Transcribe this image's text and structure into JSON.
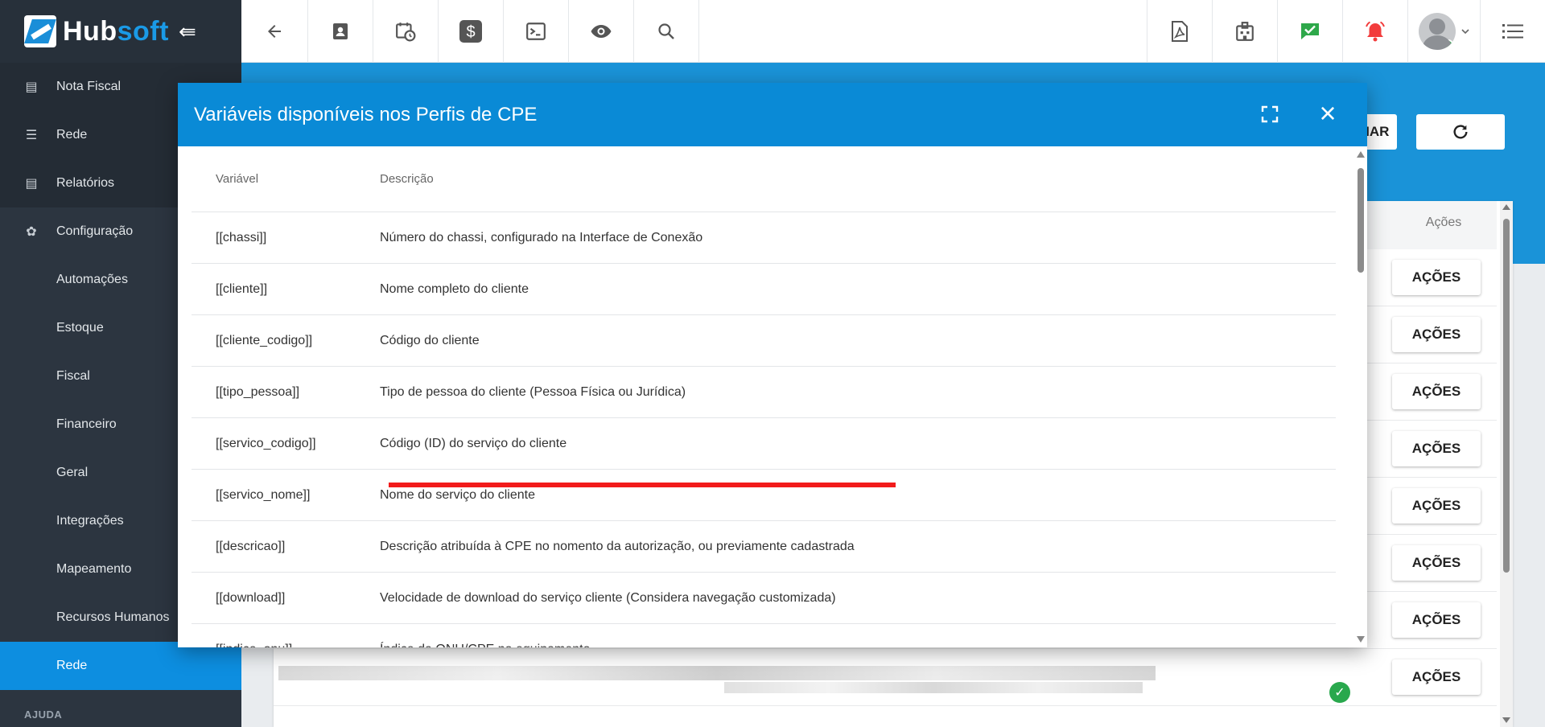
{
  "brand": {
    "name_part1": "Hub",
    "name_part2": "soft",
    "collapse_glyph": "⇚"
  },
  "sidebar": {
    "items": [
      {
        "label": "Nota Fiscal",
        "icon": "list-icon",
        "glyph": "▤",
        "level": "top"
      },
      {
        "label": "Rede",
        "icon": "server-icon",
        "glyph": "☰",
        "level": "top"
      },
      {
        "label": "Relatórios",
        "icon": "document-icon",
        "glyph": "▤",
        "level": "top"
      },
      {
        "label": "Configuração",
        "icon": "gear-icon",
        "glyph": "✿",
        "level": "top"
      },
      {
        "label": "Automações",
        "level": "sub"
      },
      {
        "label": "Estoque",
        "level": "sub"
      },
      {
        "label": "Fiscal",
        "level": "sub"
      },
      {
        "label": "Financeiro",
        "level": "sub"
      },
      {
        "label": "Geral",
        "level": "sub"
      },
      {
        "label": "Integrações",
        "level": "sub"
      },
      {
        "label": "Mapeamento",
        "level": "sub"
      },
      {
        "label": "Recursos Humanos",
        "level": "sub"
      },
      {
        "label": "Rede",
        "level": "sub",
        "active": true
      }
    ],
    "section_label": "AJUDA"
  },
  "topbar": {
    "left_icons": [
      "back-arrow-icon",
      "contact-card-icon",
      "calendar-clock-icon",
      "dollar-icon",
      "terminal-icon",
      "eye-icon",
      "search-icon"
    ],
    "right_icons": [
      "pdf-icon",
      "building-icon",
      "chat-check-icon",
      "alarm-bell-icon",
      "avatar",
      "menu-icon"
    ]
  },
  "background_page": {
    "partial_button_label": "NAR",
    "actions_header": "Ações",
    "action_button_label": "AÇÕES",
    "row_count": 8
  },
  "modal": {
    "title": "Variáveis disponíveis nos Perfis de CPE",
    "columns": {
      "variable": "Variável",
      "description": "Descrição"
    },
    "rows": [
      {
        "variable": "[[chassi]]",
        "description": "Número do chassi, configurado na Interface de Conexão"
      },
      {
        "variable": "[[cliente]]",
        "description": "Nome completo do cliente"
      },
      {
        "variable": "[[cliente_codigo]]",
        "description": "Código do cliente"
      },
      {
        "variable": "[[tipo_pessoa]]",
        "description": "Tipo de pessoa do cliente (Pessoa Física ou Jurídica)",
        "highlighted": true
      },
      {
        "variable": "[[servico_codigo]]",
        "description": "Código (ID) do serviço do cliente"
      },
      {
        "variable": "[[servico_nome]]",
        "description": "Nome do serviço do cliente"
      },
      {
        "variable": "[[descricao]]",
        "description": "Descrição atribuída à CPE no nomento da autorização, ou previamente cadastrada"
      },
      {
        "variable": "[[download]]",
        "description": "Velocidade de download do serviço cliente (Considera navegação customizada)"
      },
      {
        "variable": "[[indice_onu]]",
        "description": "Índice da ONU/CPE no equipamento"
      }
    ],
    "highlight_color": "#f21b1b"
  }
}
